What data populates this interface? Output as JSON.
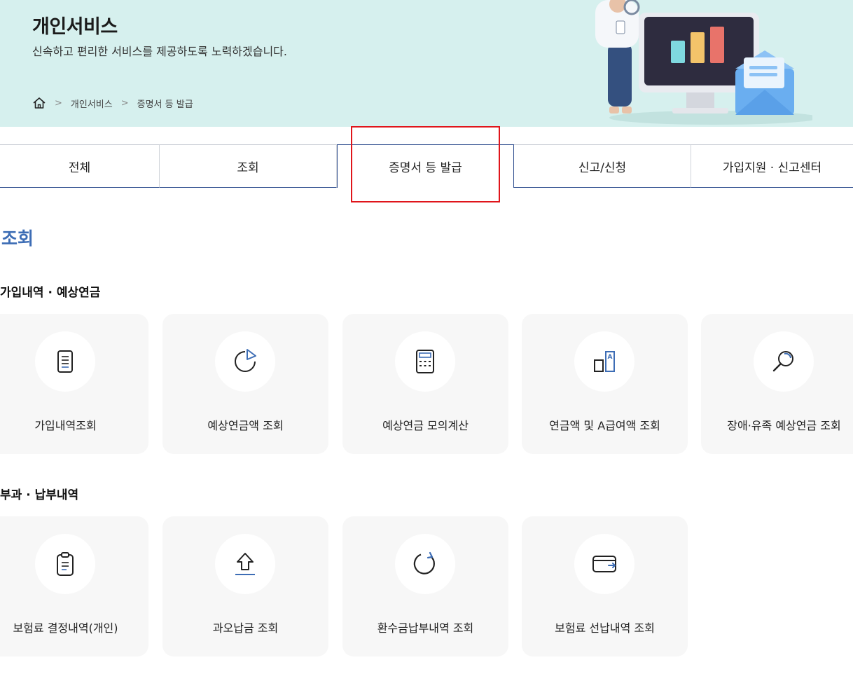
{
  "hero": {
    "title": "개인서비스",
    "subtitle": "신속하고 편리한 서비스를 제공하도록 노력하겠습니다.",
    "breadcrumb": [
      "개인서비스",
      "증명서 등 발급"
    ]
  },
  "tabs": [
    "전체",
    "조회",
    "증명서 등 발급",
    "신고/신청",
    "가입지원 · 신고센터"
  ],
  "selected_tab": "증명서 등 발급",
  "section_title": "조회",
  "groups": [
    {
      "title": "가입내역 · 예상연금",
      "items": [
        {
          "label": "가입내역조회",
          "icon": "document-list-icon"
        },
        {
          "label": "예상연금액 조회",
          "icon": "pie-chart-icon"
        },
        {
          "label": "예상연금 모의계산",
          "icon": "calculator-icon"
        },
        {
          "label": "연금액 및 A급여액 조회",
          "icon": "bar-compare-icon"
        },
        {
          "label": "장애·유족 예상연금 조회",
          "icon": "magnifier-icon"
        }
      ]
    },
    {
      "title": "부과 · 납부내역",
      "items": [
        {
          "label": "보험료 결정내역(개인)",
          "icon": "clipboard-icon"
        },
        {
          "label": "과오납금 조회",
          "icon": "upload-arrow-icon"
        },
        {
          "label": "환수금납부내역 조회",
          "icon": "refresh-icon"
        },
        {
          "label": "보험료 선납내역 조회",
          "icon": "wallet-icon"
        }
      ]
    }
  ],
  "colors": {
    "hero_bg": "#d6f0ee",
    "accent_blue": "#3d6db5",
    "tab_border": "#2e4d8e",
    "highlight_red": "#e0151b",
    "card_bg": "#f7f7f7"
  }
}
